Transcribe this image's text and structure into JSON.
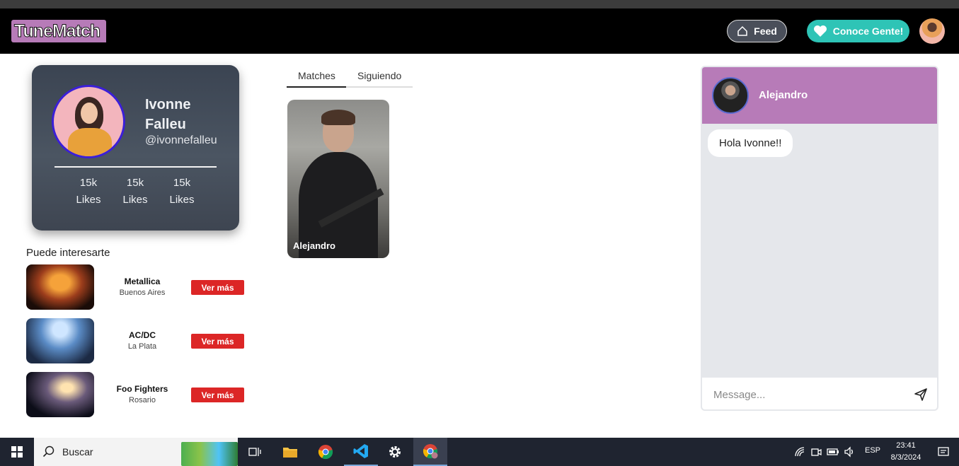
{
  "app": {
    "logo": "TuneMatch",
    "nav": {
      "feed_label": "Feed",
      "conoce_label": "Conoce Gente!"
    }
  },
  "profile": {
    "name": "Ivonne Falleu",
    "handle": "@ivonnefalleu",
    "stats": [
      {
        "value": "15k",
        "label": "Likes"
      },
      {
        "value": "15k",
        "label": "Likes"
      },
      {
        "value": "15k",
        "label": "Likes"
      }
    ]
  },
  "suggestions": {
    "title": "Puede interesarte",
    "items": [
      {
        "name": "Metallica",
        "location": "Buenos Aires",
        "button": "Ver más"
      },
      {
        "name": "AC/DC",
        "location": "La Plata",
        "button": "Ver más"
      },
      {
        "name": "Foo Fighters",
        "location": "Rosario",
        "button": "Ver más"
      }
    ]
  },
  "tabs": [
    {
      "label": "Matches"
    },
    {
      "label": "Siguiendo"
    }
  ],
  "matches": [
    {
      "name": "Alejandro"
    }
  ],
  "chat": {
    "contact": "Alejandro",
    "messages": [
      {
        "text": "Hola Ivonne!!"
      }
    ],
    "input_placeholder": "Message..."
  },
  "taskbar": {
    "search_label": "Buscar",
    "language": "ESP",
    "time": "23:41",
    "date": "8/3/2024"
  }
}
